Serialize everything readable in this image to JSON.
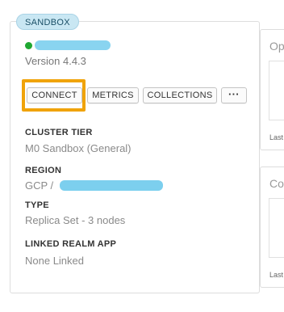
{
  "cluster": {
    "badge": "SANDBOX",
    "version": "Version 4.4.3",
    "status_color": "#1fa832",
    "highlight_color": "#f0a30a",
    "actions": {
      "connect": "CONNECT",
      "metrics": "METRICS",
      "collections": "COLLECTIONS",
      "more": "···"
    },
    "fields": [
      {
        "label": "CLUSTER TIER",
        "value": "M0 Sandbox (General)"
      },
      {
        "label": "REGION",
        "value": "GCP /"
      },
      {
        "label": "TYPE",
        "value": "Replica Set - 3 nodes"
      },
      {
        "label": "LINKED REALM APP",
        "value": "None Linked"
      }
    ]
  },
  "side_cards": [
    {
      "title": "Op",
      "caption": "Last"
    },
    {
      "title": "Co",
      "caption": "Last"
    }
  ]
}
